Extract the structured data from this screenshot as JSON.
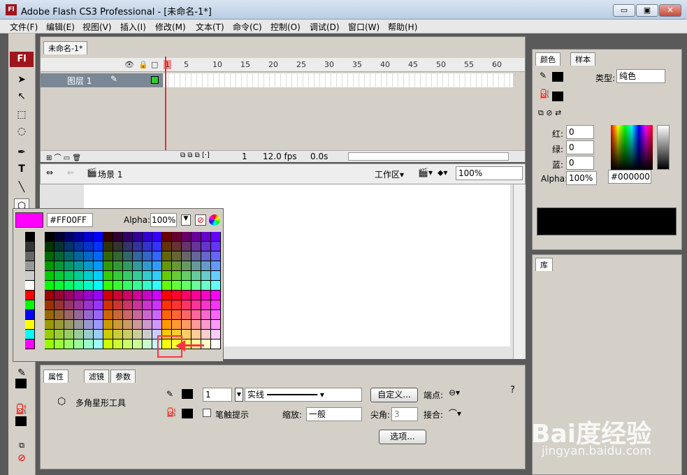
{
  "window": {
    "title": "Adobe Flash CS3 Professional - [未命名-1*]",
    "app_icon": "Fl",
    "min": "▭",
    "max": "▣",
    "close": "✕"
  },
  "menu": [
    "文件(F)",
    "编辑(E)",
    "视图(V)",
    "插入(I)",
    "修改(M)",
    "文本(T)",
    "命令(C)",
    "控制(O)",
    "调试(D)",
    "窗口(W)",
    "帮助(H)"
  ],
  "toolbox": {
    "logo": "Fl"
  },
  "timeline": {
    "doc_tab": "未命名-1*",
    "ruler": [
      "1",
      "5",
      "10",
      "15",
      "20",
      "25",
      "30",
      "35",
      "40",
      "45",
      "50",
      "55",
      "60"
    ],
    "layer_name": "图层 1",
    "frame": "1",
    "fps": "12.0 fps",
    "time": "0.0s"
  },
  "stage": {
    "scene": "场景 1",
    "workspace": "工作区▾",
    "zoom": "100%"
  },
  "swatch": {
    "current_color": "#FF00FF",
    "hex_value": "#FF00FF",
    "alpha_label": "Alpha:",
    "alpha_value": "100%"
  },
  "properties": {
    "tabs": [
      "属性",
      "滤镜",
      "参数"
    ],
    "tool_name": "多角星形工具",
    "stroke_size": "1",
    "stroke_style": "实线",
    "custom_button": "自定义...",
    "cap_label": "端点:",
    "hinting_label": "笔触提示",
    "scale_label": "缩放:",
    "scale_value": "一般",
    "miter_label": "尖角:",
    "miter_value": "3",
    "join_label": "接合:",
    "options_button": "选项..."
  },
  "color_panel": {
    "tabs": [
      "颜色",
      "样本"
    ],
    "type_label": "类型:",
    "type_value": "纯色",
    "red_label": "红:",
    "red_value": "0",
    "green_label": "绿:",
    "green_value": "0",
    "blue_label": "蓝:",
    "blue_value": "0",
    "alpha_label": "Alpha:",
    "alpha_value": "100%",
    "hex_value": "#000000"
  },
  "library_panel": {
    "tab": "库"
  },
  "watermark": {
    "brand": "Bai度经验",
    "url": "jingyan.baidu.com"
  }
}
